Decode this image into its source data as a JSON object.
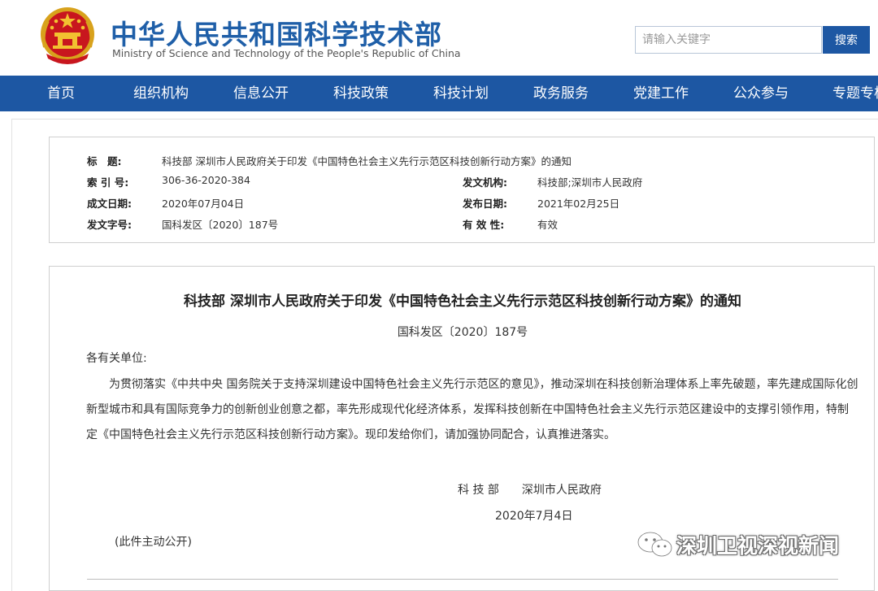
{
  "header": {
    "title_cn": "中华人民共和国科学技术部",
    "title_en": "Ministry of Science and Technology of the People's Republic of China",
    "search_placeholder": "请输入关键字",
    "search_button": "搜索",
    "emblem_icon": "national-emblem-icon",
    "brand_color": "#1f5fa8",
    "nav_color": "#1d57a3"
  },
  "nav": {
    "items": [
      "首页",
      "组织机构",
      "信息公开",
      "科技政策",
      "科技计划",
      "政务服务",
      "党建工作",
      "公众参与",
      "专题专栏"
    ]
  },
  "info": {
    "title_label": "标　题:",
    "title_value": "科技部 深圳市人民政府关于印发《中国特色社会主义先行示范区科技创新行动方案》的通知",
    "index_label": "索 引 号:",
    "index_value": "306-36-2020-384",
    "issuer_label": "发文机构:",
    "issuer_value": "科技部;深圳市人民政府",
    "created_label": "成文日期:",
    "created_value": "2020年07月04日",
    "published_label": "发布日期:",
    "published_value": "2021年02月25日",
    "docno_label": "发文字号:",
    "docno_value": "国科发区〔2020〕187号",
    "validity_label": "有 效 性:",
    "validity_value": "有效"
  },
  "article": {
    "title": "科技部 深圳市人民政府关于印发《中国特色社会主义先行示范区科技创新行动方案》的通知",
    "doc_no": "国科发区〔2020〕187号",
    "salutation": "各有关单位:",
    "body": "为贯彻落实《中共中央 国务院关于支持深圳建设中国特色社会主义先行示范区的意见》，推动深圳在科技创新治理体系上率先破题，率先建成国际化创新型城市和具有国际竞争力的创新创业创意之都，率先形成现代化经济体系，发挥科技创新在中国特色社会主义先行示范区建设中的支撑引领作用，特制定《中国特色社会主义先行示范区科技创新行动方案》。现印发给你们，请加强协同配合，认真推进落实。",
    "signer": "科 技 部　　深圳市人民政府",
    "date": "2020年7月4日",
    "public_note": "(此件主动公开)"
  },
  "watermark": {
    "text": "深圳卫视深视新闻",
    "icon": "wechat-icon"
  }
}
